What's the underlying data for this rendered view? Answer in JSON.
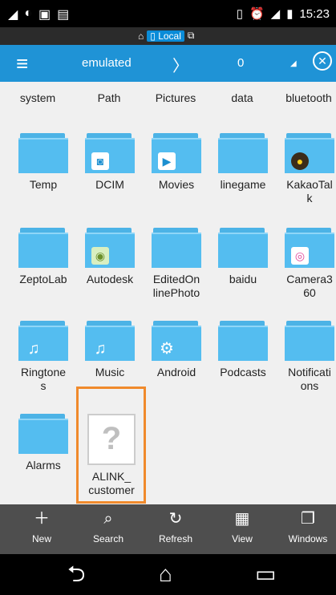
{
  "status_bar": {
    "time": "15:23"
  },
  "location": {
    "label": "Local"
  },
  "header": {
    "path": "emulated",
    "chevron": "〉",
    "count": "0"
  },
  "grid": {
    "top_labels": [
      "system",
      "Path",
      "Pictures",
      "data",
      "bluetooth"
    ],
    "rows": [
      [
        {
          "name": "Temp"
        },
        {
          "name": "DCIM",
          "badge": "camera-icon"
        },
        {
          "name": "Movies",
          "badge": "play-icon"
        },
        {
          "name": "linegame"
        },
        {
          "name": "KakaoTal\nk",
          "badge": "kakao-icon"
        }
      ],
      [
        {
          "name": "ZeptoLab"
        },
        {
          "name": "Autodesk",
          "badge": "autodesk-icon"
        },
        {
          "name": "EditedOn\nlinePhoto"
        },
        {
          "name": "baidu"
        },
        {
          "name": "Camera3\n60",
          "badge": "camera360-icon"
        }
      ],
      [
        {
          "name": "Ringtone\ns",
          "badge": "music-note-icon"
        },
        {
          "name": "Music",
          "badge": "music-note-icon"
        },
        {
          "name": "Android",
          "badge": "gear-icon"
        },
        {
          "name": "Podcasts"
        },
        {
          "name": "Notificati\nons"
        }
      ],
      [
        {
          "name": "Alarms"
        },
        {
          "name": "ALINK_\ncustomer",
          "type": "unknown-file",
          "selected": true
        }
      ]
    ]
  },
  "toolbar": {
    "items": [
      {
        "label": "New",
        "icon": "plus-icon"
      },
      {
        "label": "Search",
        "icon": "search-icon"
      },
      {
        "label": "Refresh",
        "icon": "refresh-icon"
      },
      {
        "label": "View",
        "icon": "grid-view-icon"
      },
      {
        "label": "Windows",
        "icon": "windows-icon"
      }
    ]
  },
  "colors": {
    "header": "#1f93d6",
    "folder": "#54bdf0",
    "selection": "#f08a2c",
    "toolbar": "#4e4e4e"
  }
}
